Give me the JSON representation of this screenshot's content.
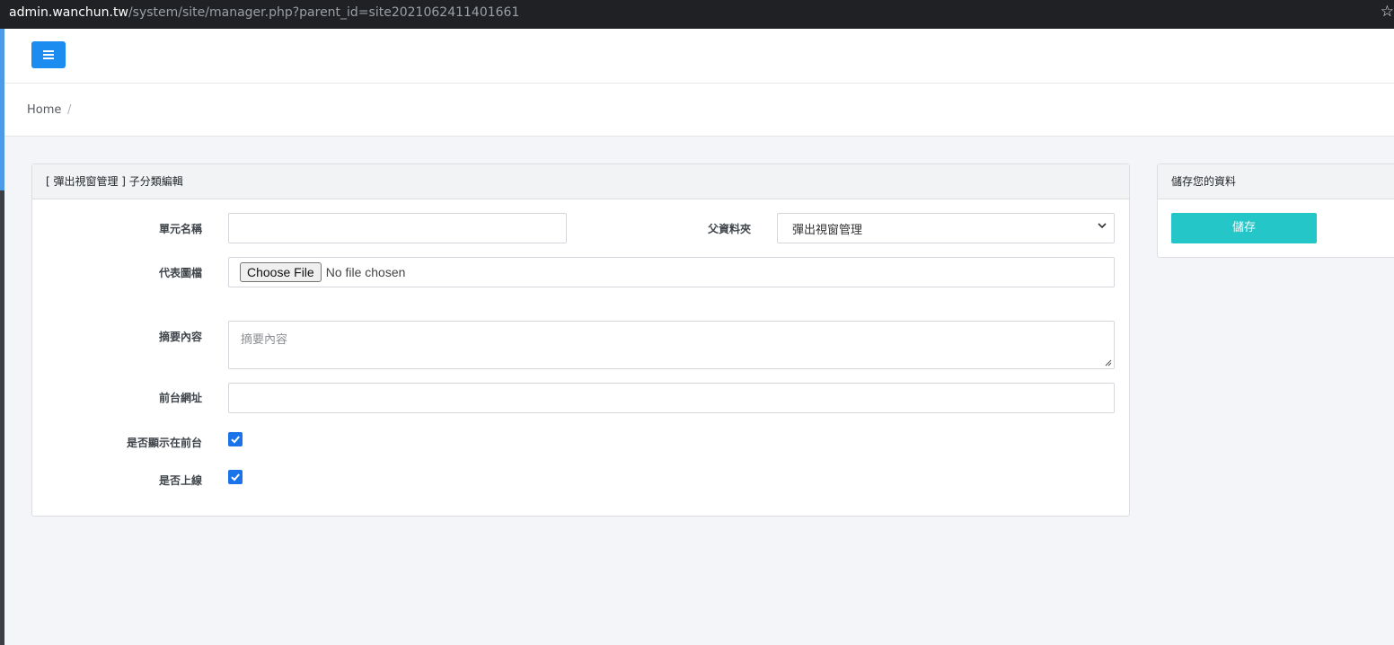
{
  "browser": {
    "url_host": "admin.wanchun.tw",
    "url_path": "/system/site/manager.php?parent_id=site2021062411401661",
    "star_icon": "star-outline-icon"
  },
  "header": {
    "menu_icon": "hamburger-menu-icon",
    "accent_color": "#1d8cf0"
  },
  "breadcrumb": {
    "home": "Home",
    "separator": "/"
  },
  "form_card": {
    "title": "[ 彈出視窗管理 ] 子分類編輯",
    "fields": {
      "unit_name": {
        "label": "單元名稱",
        "value": ""
      },
      "parent_folder": {
        "label": "父資料夾",
        "selected": "彈出視窗管理"
      },
      "image": {
        "label": "代表圖檔",
        "button": "Choose File",
        "status": "No file chosen"
      },
      "summary": {
        "label": "摘要內容",
        "placeholder": "摘要內容",
        "value": ""
      },
      "frontend_url": {
        "label": "前台網址",
        "value": ""
      },
      "show_on_frontend": {
        "label": "是否顯示在前台",
        "checked": true
      },
      "online": {
        "label": "是否上線",
        "checked": true
      }
    }
  },
  "save_card": {
    "title": "儲存您的資料",
    "save_button": "儲存",
    "button_color": "#24c6c8"
  }
}
